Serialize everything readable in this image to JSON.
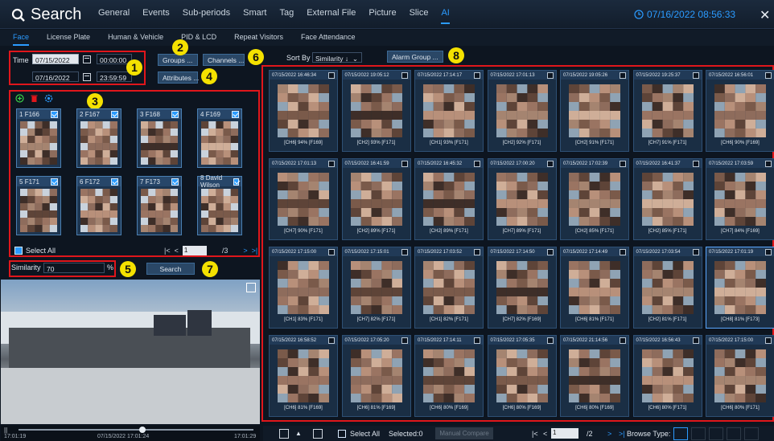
{
  "app": {
    "title": "Search",
    "main_nav": [
      "General",
      "Events",
      "Sub-periods",
      "Smart",
      "Tag",
      "External File",
      "Picture",
      "Slice",
      "AI"
    ],
    "main_nav_active": "AI",
    "datetime": "07/16/2022 08:56:33"
  },
  "sub_nav": [
    "Face",
    "License Plate",
    "Human & Vehicle",
    "PID & LCD",
    "Repeat Visitors",
    "Face Attendance"
  ],
  "sub_nav_active": "Face",
  "time": {
    "label": "Time",
    "start_date": "07/15/2022",
    "start_time": "00:00:00",
    "end_date": "07/16/2022",
    "end_time": "23:59:59"
  },
  "filters": {
    "groups_button": "Groups ...",
    "channels_button": "Channels ...",
    "attributes_button": "Attributes ..."
  },
  "faces": [
    {
      "index": "1",
      "name": "F166"
    },
    {
      "index": "2",
      "name": "F167"
    },
    {
      "index": "3",
      "name": "F168"
    },
    {
      "index": "4",
      "name": "F169"
    },
    {
      "index": "5",
      "name": "F171"
    },
    {
      "index": "6",
      "name": "F172"
    },
    {
      "index": "7",
      "name": "F173"
    },
    {
      "index": "8",
      "name": "David Wilson"
    }
  ],
  "face_pager": {
    "select_all": "Select All",
    "page": "1",
    "total": "/3"
  },
  "similarity": {
    "label": "Similarity",
    "value": "70",
    "unit": "%"
  },
  "search_button": "Search",
  "annotations": [
    "1",
    "2",
    "3",
    "4",
    "5",
    "6",
    "7",
    "8"
  ],
  "results_header": {
    "sort_label": "Sort By",
    "sort_value": "Similarity ↓",
    "alarm_group_button": "Alarm Group ..."
  },
  "results": [
    {
      "ts": "07/15/2022 16:46:34",
      "caption": "[CH6] 94% [F169]"
    },
    {
      "ts": "07/15/2022 19:05:12",
      "caption": "[CH2] 93% [F171]"
    },
    {
      "ts": "07/15/2022 17:14:17",
      "caption": "[CH1] 93% [F171]"
    },
    {
      "ts": "07/15/2022 17:01:13",
      "caption": "[CH2] 92% [F171]"
    },
    {
      "ts": "07/15/2022 19:05:26",
      "caption": "[CH2] 91% [F171]"
    },
    {
      "ts": "07/15/2022 19:25:37",
      "caption": "[CH7] 91% [F171]"
    },
    {
      "ts": "07/15/2022 16:56:01",
      "caption": "[CH6] 90% [F169]"
    },
    {
      "ts": "07/15/2022 17:01:13",
      "caption": "[CH7] 90% [F171]"
    },
    {
      "ts": "07/15/2022 16:41:59",
      "caption": "[CH2] 89% [F171]"
    },
    {
      "ts": "07/15/2022 16:45:32",
      "caption": "[CH2] 89% [F171]"
    },
    {
      "ts": "07/15/2022 17:00:20",
      "caption": "[CH7] 89% [F171]"
    },
    {
      "ts": "07/15/2022 17:02:39",
      "caption": "[CH2] 85% [F171]"
    },
    {
      "ts": "07/15/2022 16:41:37",
      "caption": "[CH2] 85% [F171]"
    },
    {
      "ts": "07/15/2022 17:03:59",
      "caption": "[CH7] 84% [F169]"
    },
    {
      "ts": "07/15/2022 17:15:00",
      "caption": "[CH1] 83% [F171]"
    },
    {
      "ts": "07/15/2022 17:15:01",
      "caption": "[CH7] 82% [F171]"
    },
    {
      "ts": "07/15/2022 17:03:52",
      "caption": "[CH1] 82% [F171]"
    },
    {
      "ts": "07/15/2022 17:14:50",
      "caption": "[CH7] 82% [F169]"
    },
    {
      "ts": "07/15/2022 17:14:49",
      "caption": "[CH6] 81% [F171]"
    },
    {
      "ts": "07/15/2022 17:03:54",
      "caption": "[CH2] 81% [F171]"
    },
    {
      "ts": "07/15/2022 17:01:19",
      "caption": "[CH8] 81% [F173]"
    },
    {
      "ts": "07/15/2022 16:58:52",
      "caption": "[CH6] 81% [F169]"
    },
    {
      "ts": "07/15/2022 17:05:20",
      "caption": "[CH6] 81% [F169]"
    },
    {
      "ts": "07/15/2022 17:14:11",
      "caption": "[CH6] 80% [F169]"
    },
    {
      "ts": "07/15/2022 17:05:35",
      "caption": "[CH6] 80% [F169]"
    },
    {
      "ts": "07/15/2022 21:14:56",
      "caption": "[CH6] 80% [F169]"
    },
    {
      "ts": "07/15/2022 16:56:43",
      "caption": "[CH6] 80% [F171]"
    },
    {
      "ts": "07/15/2022 17:15:00",
      "caption": "[CH6] 80% [F171]"
    }
  ],
  "playback": {
    "start_time": "17:01:19",
    "mid_time": "07/15/2022 17:01:24",
    "end_time": "17:01:29"
  },
  "bottom_bar": {
    "select_all": "Select All",
    "selected": "Selected:0",
    "manual_compare": "Manual Compare",
    "page": "1",
    "total": "/2",
    "browse_type": "Browse Type:"
  }
}
